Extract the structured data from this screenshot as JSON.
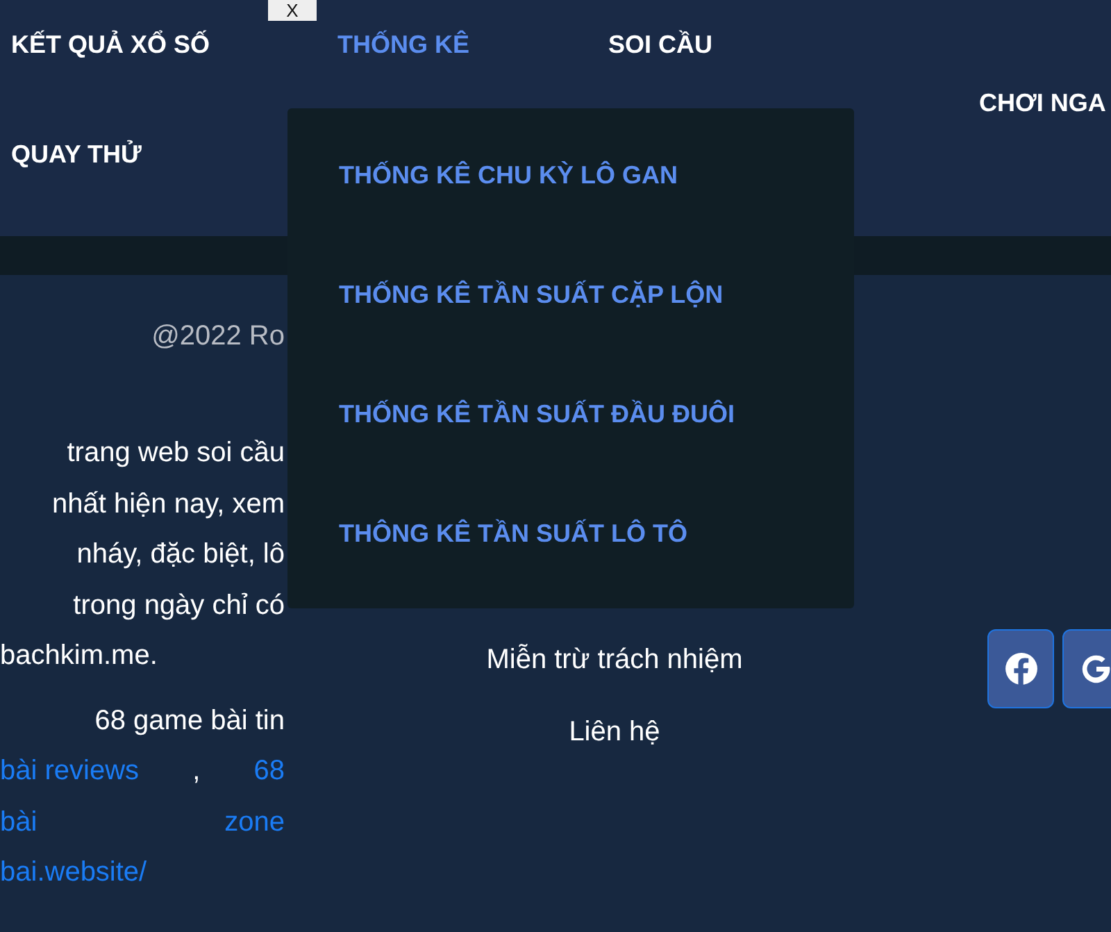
{
  "close_button": "X",
  "nav": [
    {
      "label": "KẾT QUẢ XỔ SỐ",
      "selected": false
    },
    {
      "label": "THỐNG KÊ",
      "selected": true
    },
    {
      "label": "SOI CẦU",
      "selected": false
    },
    {
      "label": "CHƠI NGA",
      "selected": false
    },
    {
      "label": "QUAY THỬ",
      "selected": false
    }
  ],
  "dropdown": [
    "THỐNG KÊ CHU KỲ LÔ GAN",
    "THỐNG KÊ TẦN SUẤT CẶP LỘN",
    "THỐNG KÊ TẦN SUẤT ĐẦU ĐUÔI",
    "THÔNG KÊ TẦN SUẤT LÔ TÔ"
  ],
  "copyright": "@2022 Ro",
  "paragraphs": [
    [
      [
        {
          "text": "trang web soi cầu",
          "link": false
        }
      ],
      [
        {
          "text": "nhất hiện nay, xem",
          "link": false
        }
      ],
      [
        {
          "text": "nháy, đặc biệt, lô",
          "link": false
        }
      ],
      [
        {
          "text": "trong ngày chỉ có",
          "link": false
        }
      ],
      [
        {
          "text": "bachkim.me.",
          "link": false
        }
      ]
    ],
    [
      [
        {
          "text": "68 game bài tin",
          "link": false
        }
      ],
      [
        {
          "text": "bài reviews",
          "link": true
        },
        {
          "text": ",",
          "link": false
        },
        {
          "text": "68",
          "link": true
        }
      ],
      [
        {
          "text": "bài",
          "link": true
        },
        {
          "text": "zone",
          "link": true
        }
      ],
      [
        {
          "text": "bai.website/",
          "link": true
        }
      ]
    ]
  ],
  "footer_links": [
    "Miễn trừ trách nhiệm",
    "Liên hệ"
  ],
  "social": [
    {
      "kind": "facebook"
    },
    {
      "kind": "google"
    }
  ]
}
